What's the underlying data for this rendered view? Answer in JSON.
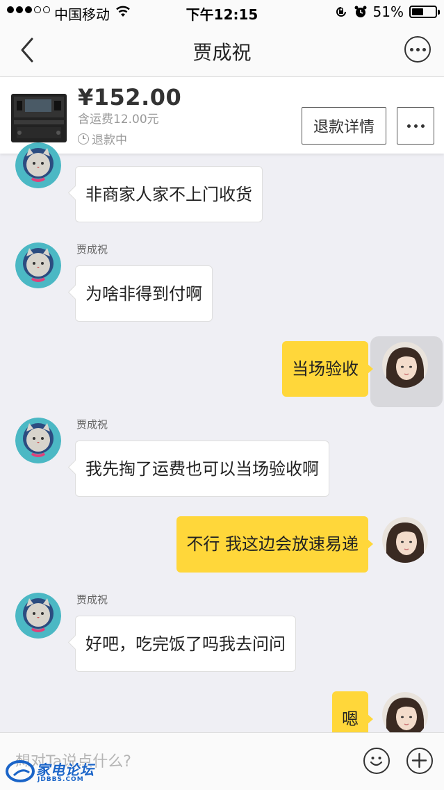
{
  "status_bar": {
    "carrier": "中国移动",
    "time": "下午12:15",
    "battery": "51%",
    "battery_level": 0.51
  },
  "nav": {
    "title": "贾成祝",
    "back_icon": "chevron-left-icon",
    "more_icon": "more-dots-icon"
  },
  "product": {
    "price": "¥152.00",
    "shipping": "含运费12.00元",
    "status": "退款中",
    "refund_button": "退款详情"
  },
  "messages": [
    {
      "side": "left",
      "sender": "",
      "text": "非商家人家不上门收货"
    },
    {
      "side": "left",
      "sender": "贾成祝",
      "text": "为啥非得到付啊"
    },
    {
      "side": "right",
      "text": "当场验收"
    },
    {
      "side": "left",
      "sender": "贾成祝",
      "text": "我先掏了运费也可以当场验收啊"
    },
    {
      "side": "right",
      "text": "不行 我这边会放速易递"
    },
    {
      "side": "left",
      "sender": "贾成祝",
      "text": "好吧，吃完饭了吗我去问问"
    },
    {
      "side": "right",
      "text": "嗯"
    }
  ],
  "input": {
    "placeholder": "想对Ta说点什么?"
  },
  "watermark": {
    "brand": "家电论坛",
    "domain": "JDBBS.COM"
  },
  "colors": {
    "self_bubble": "#ffd73a",
    "other_bubble": "#ffffff",
    "background": "#efeff4"
  }
}
